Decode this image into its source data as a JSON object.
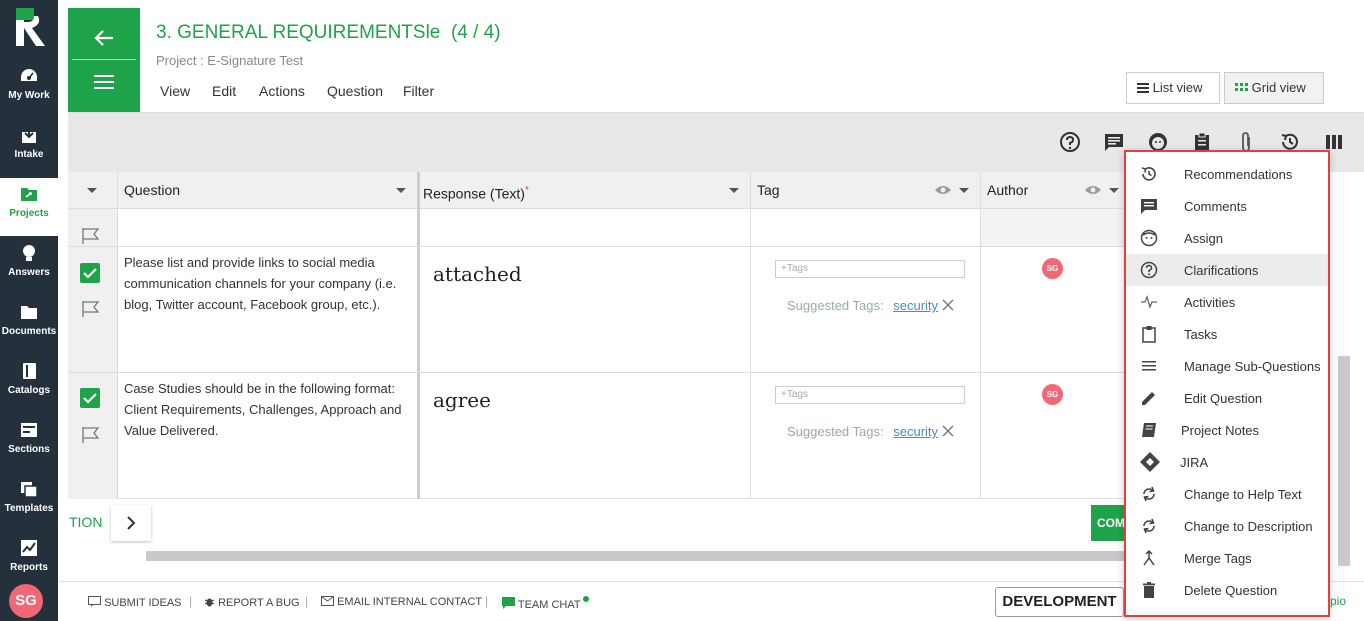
{
  "nav": {
    "items": [
      {
        "label": "My Work",
        "icon": "dashboard-icon"
      },
      {
        "label": "Intake",
        "icon": "intake-icon"
      },
      {
        "label": "Projects",
        "icon": "projects-icon"
      },
      {
        "label": "Answers",
        "icon": "bulb-icon"
      },
      {
        "label": "Documents",
        "icon": "folder-icon"
      },
      {
        "label": "Catalogs",
        "icon": "book-icon"
      },
      {
        "label": "Sections",
        "icon": "sections-icon"
      },
      {
        "label": "Templates",
        "icon": "templates-icon"
      },
      {
        "label": "Reports",
        "icon": "chart-icon"
      }
    ],
    "active": "Projects",
    "user_initials": "SG"
  },
  "header": {
    "title": "3. GENERAL REQUIREMENTSle",
    "count": "(4 / 4)",
    "subtitle": "Project : E-Signature Test",
    "menu": [
      "View",
      "Edit",
      "Actions",
      "Question",
      "Filter"
    ],
    "list_view": "List view",
    "grid_view": "Grid view"
  },
  "table": {
    "columns": {
      "question": "Question",
      "response": "Response (Text)",
      "required_mark": "*",
      "tag": "Tag",
      "author": "Author"
    },
    "rows": [
      {
        "question": "Please list and provide links to social media communication channels for your company (i.e. blog, Twitter account, Facebook group, etc.).",
        "response": "attached",
        "tag_placeholder": "+Tags",
        "suggested_label": "Suggested Tags:",
        "suggested_tag": "security",
        "author": "SG",
        "checked": true
      },
      {
        "question": "Case Studies should be in the following format: Client Requirements, Challenges, Approach and Value Delivered.",
        "response": "agree",
        "tag_placeholder": "+Tags",
        "suggested_label": "Suggested Tags:",
        "suggested_tag": "security",
        "author": "SG",
        "checked": true
      }
    ]
  },
  "bottom": {
    "section_label": "TION",
    "complete_label": "COM"
  },
  "footer": {
    "submit_ideas": "SUBMIT IDEAS",
    "report_bug": "REPORT A BUG",
    "email_contact": "EMAIL INTERNAL CONTACT",
    "team_chat": "TEAM CHAT",
    "environment": "DEVELOPMENT",
    "help_fragment": "pio"
  },
  "dropdown": {
    "items": [
      {
        "label": "Recommendations",
        "icon": "history-icon"
      },
      {
        "label": "Comments",
        "icon": "comment-icon"
      },
      {
        "label": "Assign",
        "icon": "face-icon"
      },
      {
        "label": "Clarifications",
        "icon": "help-circle-icon"
      },
      {
        "label": "Activities",
        "icon": "pulse-icon"
      },
      {
        "label": "Tasks",
        "icon": "clipboard-icon"
      },
      {
        "label": "Manage Sub-Questions",
        "icon": "lines-icon"
      },
      {
        "label": "Edit Question",
        "icon": "pencil-icon"
      },
      {
        "label": "Project Notes",
        "icon": "notebook-icon"
      },
      {
        "label": "JIRA",
        "icon": "jira-icon"
      },
      {
        "label": "Change to Help Text",
        "icon": "refresh-icon"
      },
      {
        "label": "Change to Description",
        "icon": "refresh-icon"
      },
      {
        "label": "Merge Tags",
        "icon": "merge-icon"
      },
      {
        "label": "Delete Question",
        "icon": "trash-icon"
      }
    ],
    "hovered": "Clarifications"
  },
  "colors": {
    "brand_green": "#1fa34a",
    "rail_dark": "#25303d",
    "avatar_pink": "#f06775",
    "highlight_red": "#e2403a"
  }
}
